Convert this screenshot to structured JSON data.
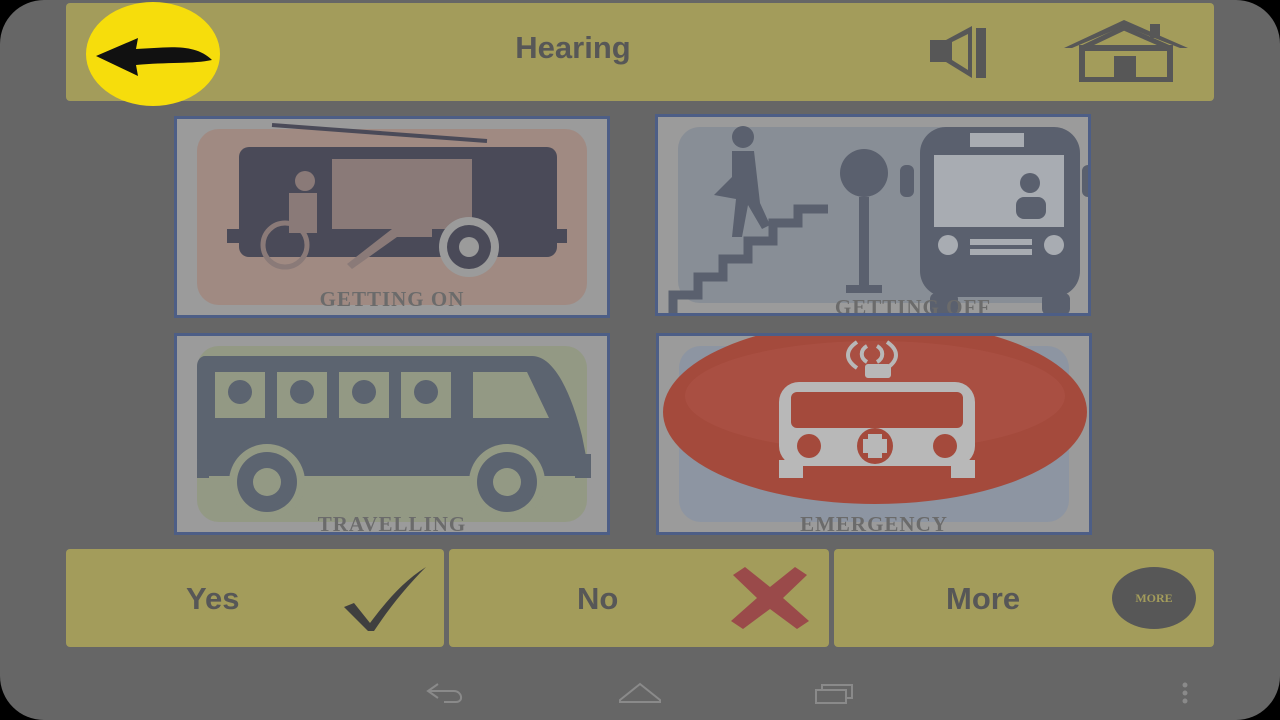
{
  "header": {
    "title": "Hearing",
    "back_icon": "back-arrow-icon",
    "speaker_icon": "speaker-icon",
    "home_icon": "home-icon"
  },
  "tiles": [
    {
      "label": "GETTING ON",
      "icon": "wheelchair-bus-icon",
      "color": "#a08a82"
    },
    {
      "label": "GETTING OFF",
      "icon": "stairs-bus-stop-icon",
      "color": "#888e96"
    },
    {
      "label": "TRAVELLING",
      "icon": "passenger-bus-icon",
      "color": "#939984"
    },
    {
      "label": "EMERGENCY",
      "icon": "ambulance-icon",
      "color": "#a44a3c"
    }
  ],
  "actions": {
    "yes_label": "Yes",
    "no_label": "No",
    "more_label": "More",
    "more_badge": "MORE"
  },
  "navbar": {
    "back_icon": "nav-back-icon",
    "home_icon": "nav-home-icon",
    "recents_icon": "nav-recents-icon",
    "menu_icon": "overflow-menu-icon"
  },
  "colors": {
    "accent": "#a39c5b",
    "back_button": "#f6dd0c",
    "no_cross": "#9a4a4a"
  }
}
